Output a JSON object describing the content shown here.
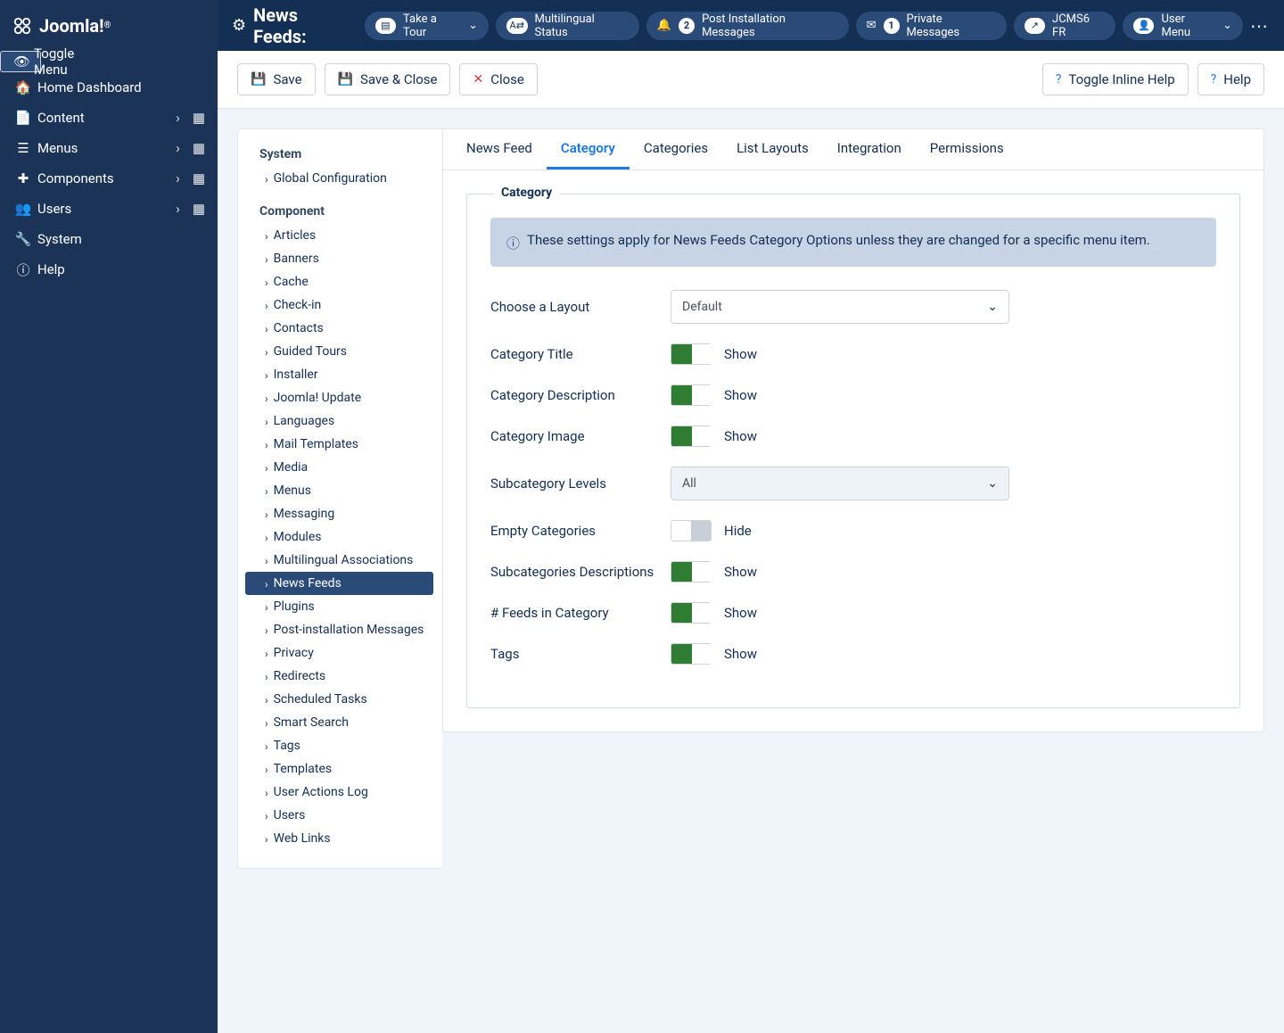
{
  "brand": "Joomla!",
  "sidebar": {
    "toggle": "Toggle Menu",
    "items": [
      {
        "label": "Home Dashboard",
        "icon": "home",
        "sub": false
      },
      {
        "label": "Content",
        "icon": "file",
        "sub": true
      },
      {
        "label": "Menus",
        "icon": "list",
        "sub": true
      },
      {
        "label": "Components",
        "icon": "puzzle",
        "sub": true
      },
      {
        "label": "Users",
        "icon": "users",
        "sub": true
      },
      {
        "label": "System",
        "icon": "wrench",
        "sub": false
      },
      {
        "label": "Help",
        "icon": "info",
        "sub": false
      }
    ]
  },
  "header": {
    "title": "News Feeds",
    "pills": [
      {
        "icon": "map",
        "label": "Take a Tour",
        "chev": true
      },
      {
        "icon": "lang",
        "label": "Multilingual Status"
      },
      {
        "icon": "bell",
        "badge": "2",
        "label": "Post Installation Messages"
      },
      {
        "icon": "mail",
        "badge": "1",
        "label": "Private Messages"
      },
      {
        "icon": "ext",
        "label": "JCMS6 FR"
      },
      {
        "icon": "user",
        "label": "User Menu",
        "chev": true
      }
    ]
  },
  "toolbar": {
    "save": "Save",
    "saveclose": "Save & Close",
    "close": "Close",
    "inlinehelp": "Toggle Inline Help",
    "help": "Help"
  },
  "config": {
    "sec1": "System",
    "sec1items": [
      "Global Configuration"
    ],
    "sec2": "Component",
    "sec2items": [
      "Articles",
      "Banners",
      "Cache",
      "Check-in",
      "Contacts",
      "Guided Tours",
      "Installer",
      "Joomla! Update",
      "Languages",
      "Mail Templates",
      "Media",
      "Menus",
      "Messaging",
      "Modules",
      "Multilingual Associations",
      "News Feeds",
      "Plugins",
      "Post-installation Messages",
      "Privacy",
      "Redirects",
      "Scheduled Tasks",
      "Smart Search",
      "Tags",
      "Templates",
      "User Actions Log",
      "Users",
      "Web Links"
    ],
    "active": "News Feeds"
  },
  "tabs": [
    "News Feed",
    "Category",
    "Categories",
    "List Layouts",
    "Integration",
    "Permissions"
  ],
  "activeTab": "Category",
  "panel": {
    "legend": "Category",
    "info": "These settings apply for News Feeds Category Options unless they are changed for a specific menu item.",
    "fields": [
      {
        "label": "Choose a Layout",
        "type": "select",
        "value": "Default"
      },
      {
        "label": "Category Title",
        "type": "toggle",
        "on": true,
        "text": "Show"
      },
      {
        "label": "Category Description",
        "type": "toggle",
        "on": true,
        "text": "Show"
      },
      {
        "label": "Category Image",
        "type": "toggle",
        "on": true,
        "text": "Show"
      },
      {
        "label": "Subcategory Levels",
        "type": "select",
        "value": "All",
        "hi": true
      },
      {
        "label": "Empty Categories",
        "type": "toggle",
        "on": false,
        "text": "Hide"
      },
      {
        "label": "Subcategories Descriptions",
        "type": "toggle",
        "on": true,
        "text": "Show"
      },
      {
        "label": "# Feeds in Category",
        "type": "toggle",
        "on": true,
        "text": "Show"
      },
      {
        "label": "Tags",
        "type": "toggle",
        "on": true,
        "text": "Show"
      }
    ]
  }
}
